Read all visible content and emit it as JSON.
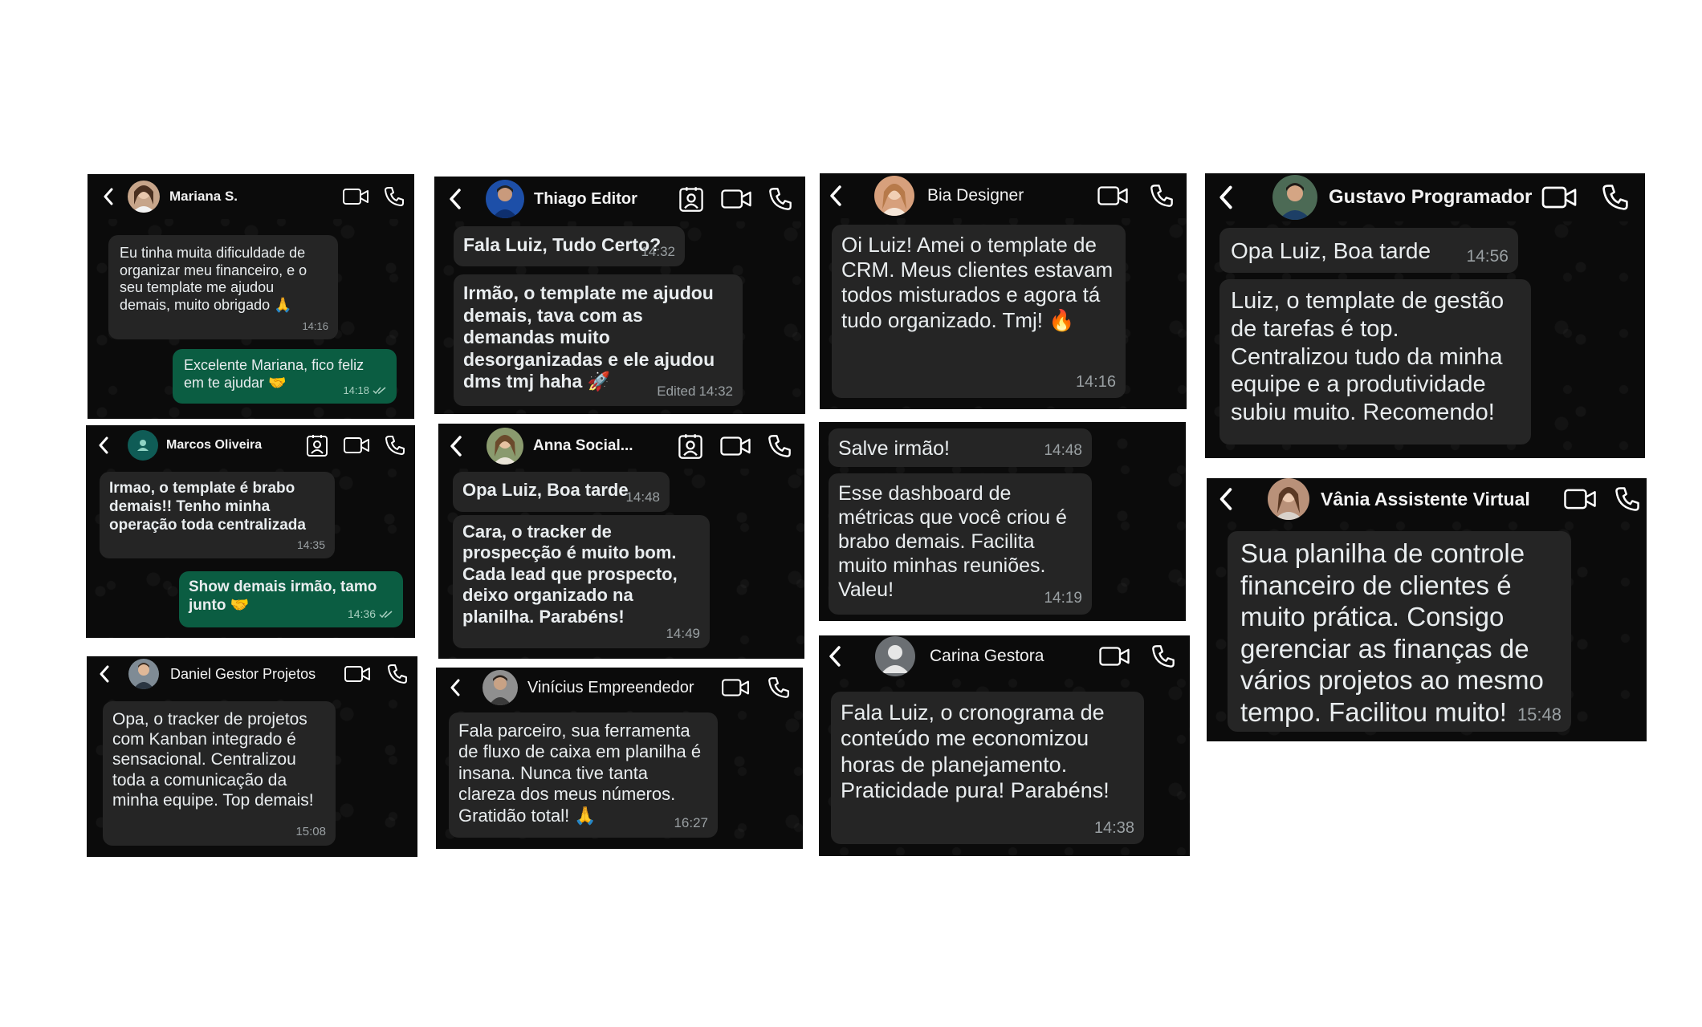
{
  "colors": {
    "page_background": "#ffffff",
    "chat_background": "#0b0b0b",
    "incoming_bubble": "#252525",
    "outgoing_bubble": "#0b5d42",
    "text": "#e9edef",
    "timestamp": "#9aa0a3",
    "accent_avatar": "#0f5c56"
  },
  "icons": {
    "back": "chevron-left-icon",
    "video": "video-camera-icon",
    "phone": "phone-icon",
    "contact": "contact-card-icon",
    "read_receipt": "double-check-icon"
  },
  "chats": {
    "mariana": {
      "contact_name": "Mariana S.",
      "messages": [
        {
          "text": "Eu tinha muita dificuldade de organizar meu financeiro, e o seu template me ajudou demais, muito obrigado 🙏",
          "time": "14:16"
        },
        {
          "text": "Excelente Mariana, fico feliz em te ajudar 🤝",
          "time": "14:18"
        }
      ]
    },
    "marcos": {
      "contact_name": "Marcos Oliveira",
      "messages": [
        {
          "text": "Irmao, o template é brabo demais!! Tenho minha operação toda centralizada",
          "time": "14:35"
        },
        {
          "text": "Show demais irmão, tamo junto 🤝",
          "time": "14:36"
        }
      ]
    },
    "daniel": {
      "contact_name": "Daniel Gestor Projetos",
      "messages": [
        {
          "text": "Opa, o tracker de projetos com Kanban integrado é sensacional. Centralizou toda a comunicação da minha equipe. Top demais!",
          "time": "15:08"
        }
      ]
    },
    "thiago": {
      "contact_name": "Thiago Editor",
      "messages": [
        {
          "text": "Fala Luiz, Tudo Certo?",
          "time": "14:32"
        },
        {
          "text": "Irmão, o template me ajudou demais, tava com as demandas muito desorganizadas e ele ajudou dms tmj haha 🚀",
          "time": "14:32",
          "edited_label": "Edited"
        }
      ]
    },
    "anna": {
      "contact_name": "Anna Social...",
      "messages": [
        {
          "text": "Opa Luiz, Boa tarde",
          "time": "14:48"
        },
        {
          "text": "Cara, o tracker de prospecção é muito bom. Cada lead que prospecto, deixo organizado na planilha. Parabéns!",
          "time": "14:49"
        }
      ]
    },
    "vinicius": {
      "contact_name": "Vinícius Empreendedor",
      "messages": [
        {
          "text": "Fala parceiro, sua ferramenta de fluxo de caixa em planilha é insana. Nunca tive tanta clareza dos meus números. Gratidão total! 🙏",
          "time": "16:27"
        }
      ]
    },
    "bia": {
      "contact_name": "Bia Designer",
      "messages": [
        {
          "text": "Oi Luiz! Amei o template de CRM. Meus clientes estavam todos misturados e agora tá tudo organizado. Tmj! 🔥",
          "time": "14:16"
        }
      ]
    },
    "salve": {
      "messages": [
        {
          "text": "Salve irmão!",
          "time": "14:48"
        },
        {
          "text": "Esse dashboard de métricas que você criou é brabo demais. Facilita muito minhas reuniões. Valeu!",
          "time": "14:19"
        }
      ]
    },
    "carina": {
      "contact_name": "Carina Gestora",
      "messages": [
        {
          "text": "Fala Luiz, o cronograma de conteúdo me economizou horas de planejamento. Praticidade pura! Parabéns!",
          "time": "14:38"
        }
      ]
    },
    "gustavo": {
      "contact_name": "Gustavo Programador",
      "messages": [
        {
          "text": "Opa Luiz, Boa tarde",
          "time": "14:56"
        },
        {
          "text": "Luiz, o template de gestão de tarefas é top. Centralizou tudo da minha equipe e a produtividade subiu muito. Recomendo!",
          "time": ""
        }
      ]
    },
    "vania": {
      "contact_name": "Vânia Assistente Virtual",
      "messages": [
        {
          "text": "Sua planilha de controle financeiro de clientes é muito prática. Consigo gerenciar as finanças de vários projetos ao mesmo tempo. Facilitou muito!",
          "time": "15:48"
        }
      ]
    }
  }
}
